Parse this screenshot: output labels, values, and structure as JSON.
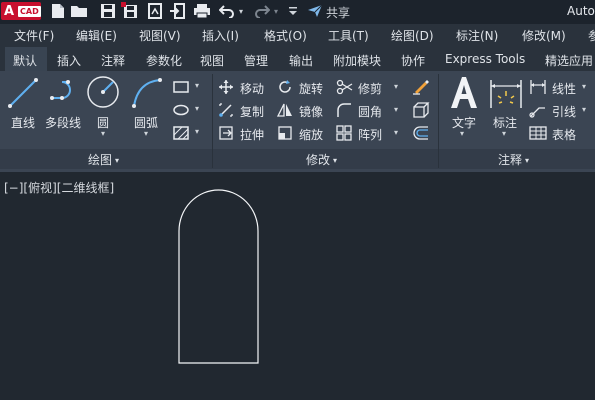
{
  "app": {
    "logo_letter": "A",
    "logo_badge": "CAD",
    "title": "Auto",
    "share_label": "共享",
    "brand_color": "#c8102e"
  },
  "quick_access": {
    "icons": [
      "new-file-icon",
      "open-folder-icon",
      "save-icon",
      "save-as-icon",
      "plot-print-icon",
      "import-icon",
      "export-icon",
      "print-icon",
      "undo-icon",
      "redo-icon",
      "customize-dropdown-icon",
      "share-icon"
    ]
  },
  "menu": {
    "items": [
      "文件(F)",
      "编辑(E)",
      "视图(V)",
      "插入(I)",
      "格式(O)",
      "工具(T)",
      "绘图(D)",
      "标注(N)",
      "修改(M)"
    ]
  },
  "tabs": {
    "items": [
      "默认",
      "插入",
      "注释",
      "参数化",
      "视图",
      "管理",
      "输出",
      "附加模块",
      "协作",
      "Express Tools",
      "精选应用"
    ],
    "active": "默认"
  },
  "ribbon": {
    "draw": {
      "title": "绘图",
      "line": "直线",
      "polyline": "多段线",
      "circle": "圆",
      "arc": "圆弧"
    },
    "modify": {
      "title": "修改",
      "move": "移动",
      "rotate": "旋转",
      "trim": "修剪",
      "copy": "复制",
      "mirror": "镜像",
      "fillet": "圆角",
      "stretch": "拉伸",
      "scale": "缩放",
      "array": "阵列"
    },
    "annotation": {
      "title": "注释",
      "text": "文字",
      "dimension": "标注",
      "linear": "线性",
      "leader": "引线",
      "table": "表格"
    }
  },
  "viewport": {
    "label": "[−][俯视][二维线框]",
    "background": "#212830"
  }
}
